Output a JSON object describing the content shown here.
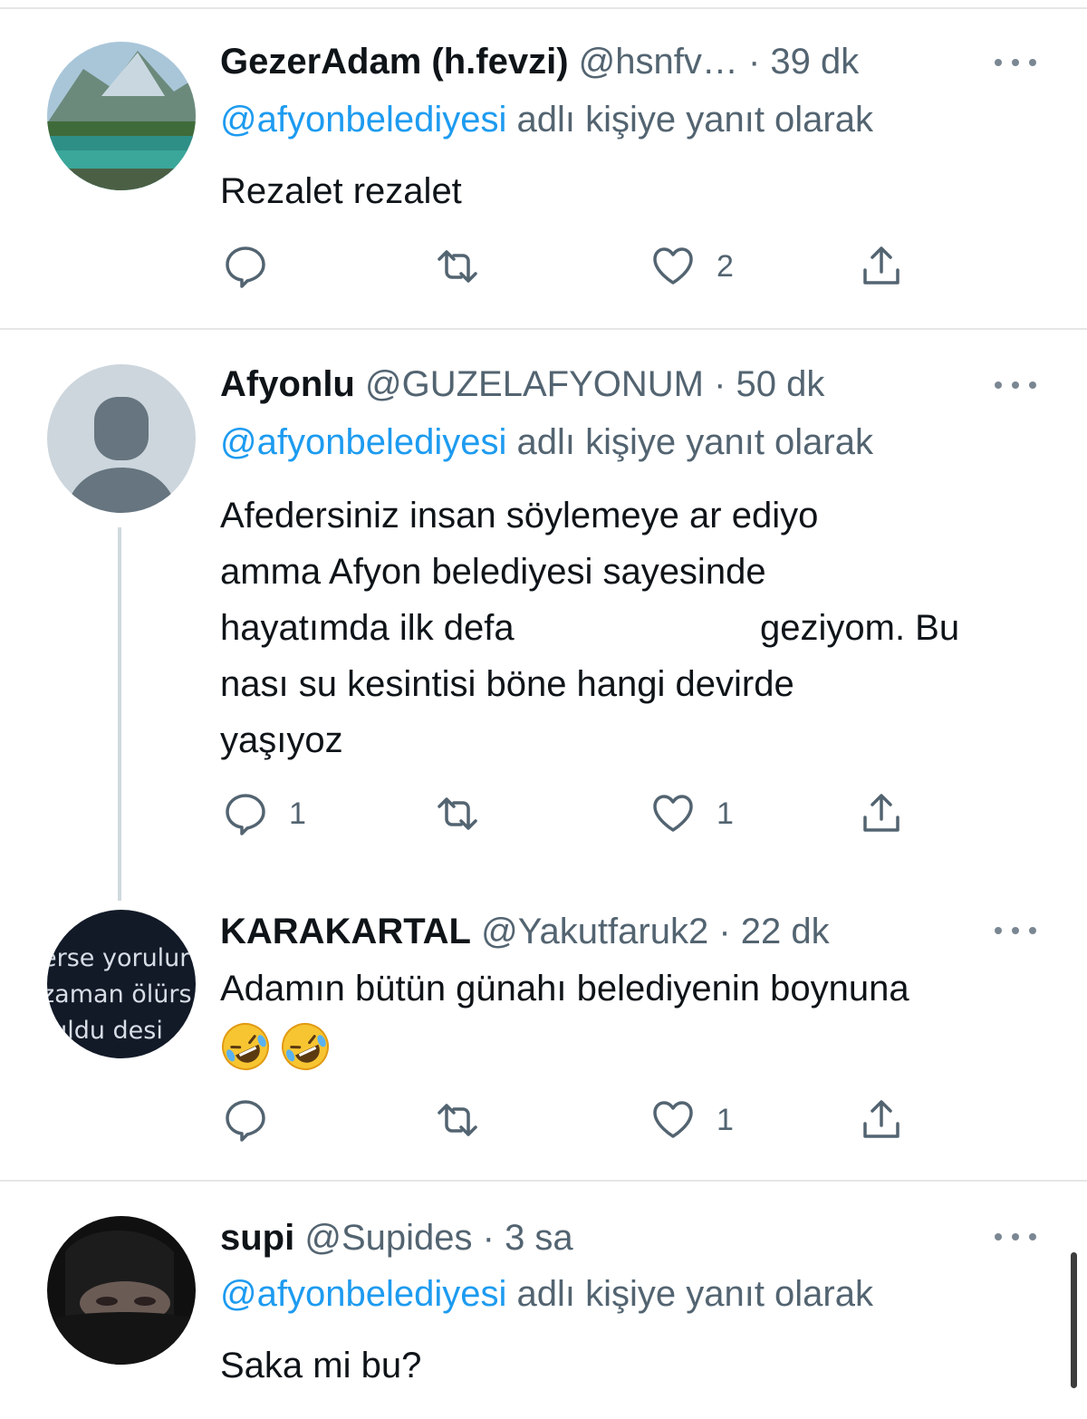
{
  "tweets": [
    {
      "name": "GezerAdam (h.fevzi)",
      "handle": "@hsnfv…",
      "time": "· 39 dk",
      "replying_mention": "@afyonbelediyesi",
      "replying_rest": " adlı kişiye yanıt olarak",
      "text": "Rezalet rezalet",
      "reply_count": "",
      "retweet_count": "",
      "like_count": "2",
      "avatar": "mountain-lake-photo"
    },
    {
      "name": "Afyonlu",
      "handle": "@GUZELAFYONUM",
      "time": "· 50 dk",
      "replying_mention": "@afyonbelediyesi",
      "replying_rest": " adlı kişiye yanıt olarak",
      "text_lines": [
        "Afedersiniz insan söylemeye ar ediyo",
        "amma Afyon belediyesi sayesinde",
        "hayatımda ilk defa",
        "geziyom. Bu",
        "nası su kesintisi böne hangi devirde",
        "yaşıyoz"
      ],
      "reply_count": "1",
      "retweet_count": "",
      "like_count": "1",
      "avatar": "default-profile"
    },
    {
      "name": "KARAKARTAL",
      "handle": "@Yakutfaruk2",
      "time": "· 22 dk",
      "text": "Adamın bütün günahı belediyenin boynuna",
      "emojis": [
        "rofl-emoji",
        "rofl-emoji"
      ],
      "avatar_text": [
        "erse yorulur",
        "zaman ölürs",
        "ruldu desi"
      ],
      "reply_count": "",
      "retweet_count": "",
      "like_count": "1"
    },
    {
      "name": "supi",
      "handle": "@Supides",
      "time": "· 3 sa",
      "replying_mention": "@afyonbelediyesi",
      "replying_rest": " adlı kişiye yanıt olarak",
      "text": "Saka mi bu?",
      "avatar": "dark-portrait-photo"
    }
  ],
  "colors": {
    "mention": "#1d9bf0",
    "secondary": "#536471",
    "text": "#0f1419",
    "divider": "#e6e6e6",
    "thread_line": "#cfd9de"
  }
}
